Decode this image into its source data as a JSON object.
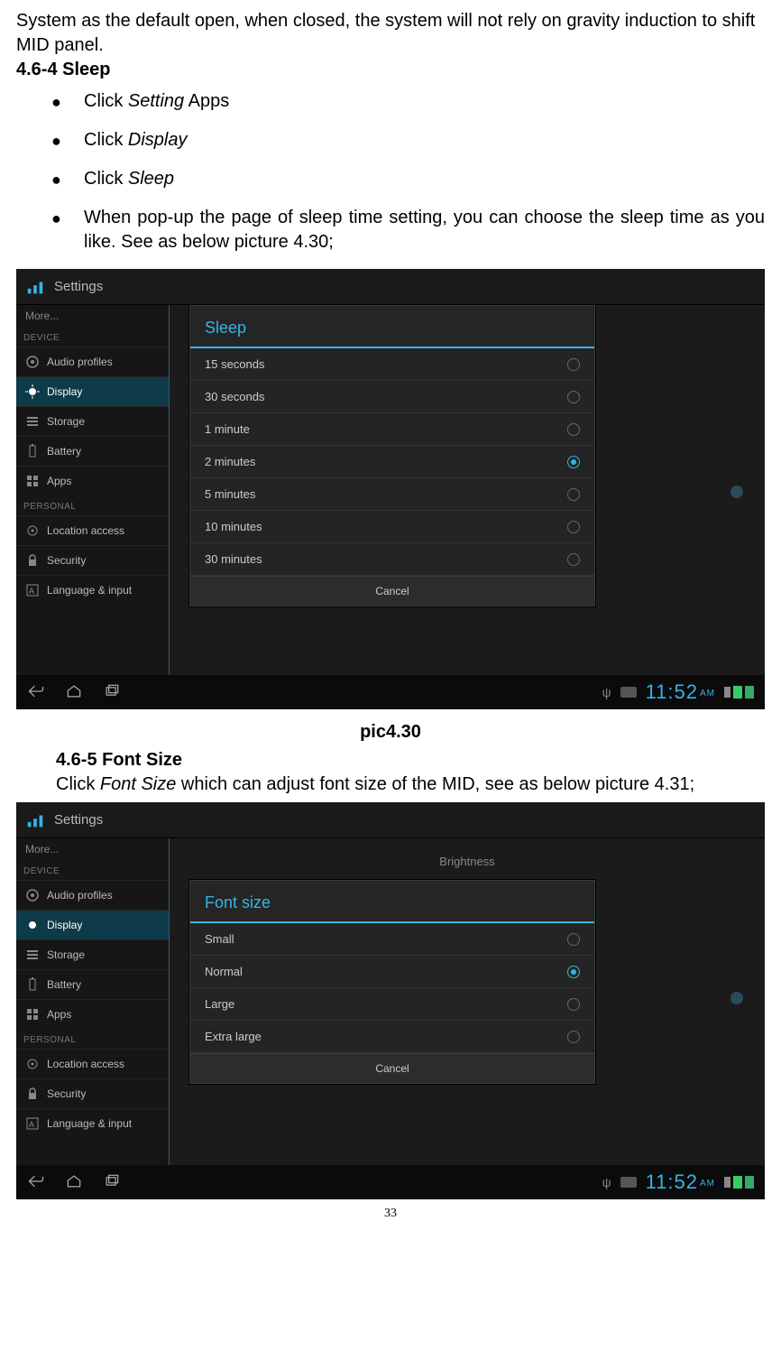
{
  "intro_line": "System as the default open, when closed, the system will not rely on gravity induction to shift MID panel.",
  "section1_heading": "4.6-4 Sleep",
  "bullets": {
    "b1a": "Click ",
    "b1b": "Setting",
    "b1c": " Apps",
    "b2a": "Click ",
    "b2b": "Display",
    "b3a": "Click ",
    "b3b": "Sleep",
    "b4": "When pop-up the page of sleep time setting, you can choose the sleep time as you like. See as below picture 4.30;"
  },
  "caption1": "pic4.30",
  "section2_heading": "4.6-5 Font Size",
  "section2_para_a": "Click ",
  "section2_para_b": "Font Size",
  "section2_para_c": " which can adjust font size of the MID, see as below picture 4.31;",
  "page_number": "33",
  "screenshot_shared": {
    "settings_title": "Settings",
    "more": "More...",
    "cat_device": "DEVICE",
    "cat_personal": "PERSONAL",
    "items": {
      "audio": "Audio profiles",
      "display": "Display",
      "storage": "Storage",
      "battery": "Battery",
      "apps": "Apps",
      "location": "Location access",
      "security": "Security",
      "language": "Language & input"
    },
    "cancel": "Cancel",
    "clock": "11:52",
    "ampm": "AM",
    "usb": "ψ"
  },
  "sleep_dialog": {
    "title": "Sleep",
    "options": [
      "15 seconds",
      "30 seconds",
      "1 minute",
      "2 minutes",
      "5 minutes",
      "10 minutes",
      "30 minutes"
    ],
    "selected_index": 3
  },
  "fontsize_dialog": {
    "title": "Font size",
    "brightness_bg": "Brightness",
    "options": [
      "Small",
      "Normal",
      "Large",
      "Extra large"
    ],
    "selected_index": 1
  }
}
